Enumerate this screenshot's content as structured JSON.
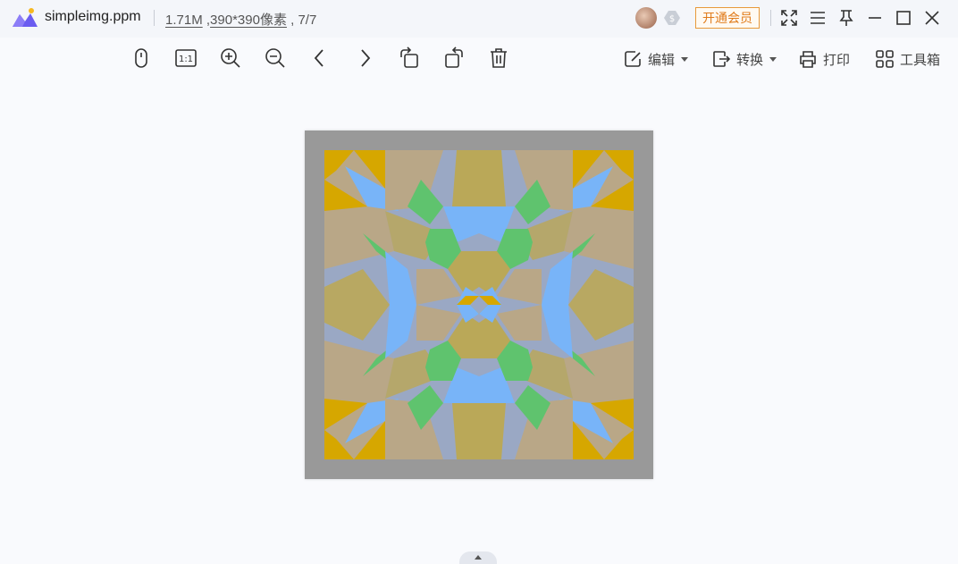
{
  "titlebar": {
    "filename": "simpleimg.ppm",
    "file_size": "1.71M",
    "dimensions": "390*390像素",
    "index": "7/7",
    "vip_label": "开通会员"
  },
  "toolbar": {
    "edit_label": "编辑",
    "convert_label": "转换",
    "print_label": "打印",
    "toolbox_label": "工具箱",
    "actual_size_label": "1:1"
  },
  "image": {
    "frame_color": "#999999",
    "gold": "#d6a700",
    "blue": "#78b4f8",
    "green": "#5fc36e",
    "slate": "#9aa8c4",
    "tan": "#b9a787"
  },
  "icons": [
    "app-logo-icon",
    "mouse-icon",
    "zoom-in-icon",
    "zoom-out-icon",
    "prev-icon",
    "next-icon",
    "rotate-left-icon",
    "rotate-right-icon",
    "delete-icon",
    "edit-icon",
    "convert-icon",
    "print-icon",
    "toolbox-icon",
    "fullscreen-icon",
    "menu-icon",
    "pin-icon",
    "minimize-icon",
    "maximize-icon",
    "close-icon"
  ]
}
